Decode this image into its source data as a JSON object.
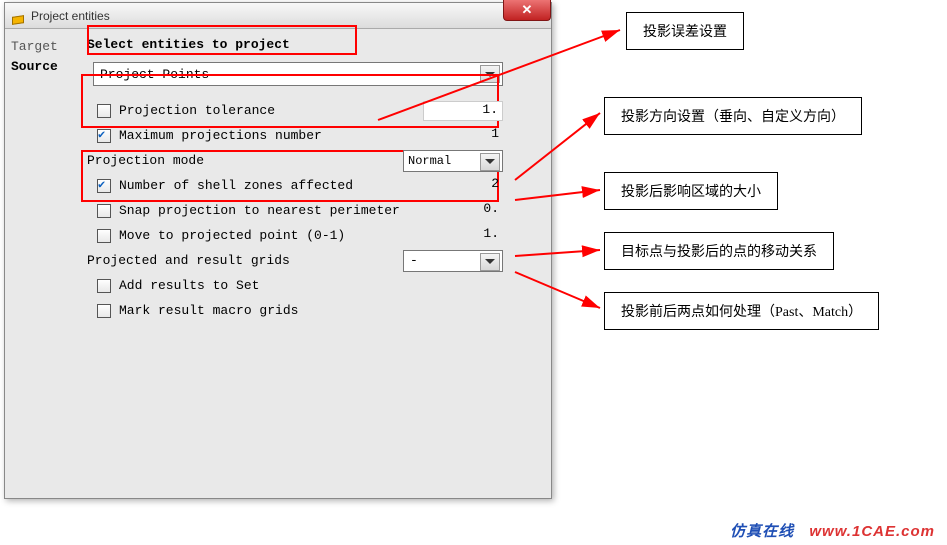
{
  "window": {
    "title": "Project entities",
    "close_glyph": "✕"
  },
  "sidebar": {
    "items": [
      {
        "label": "Target",
        "active": false
      },
      {
        "label": "Source",
        "active": true
      }
    ]
  },
  "main": {
    "heading": "Select entities to project",
    "dropdown_main": "Project Points",
    "rows": [
      {
        "id": "proj_tol",
        "checkbox": true,
        "checked": false,
        "label": "Projection tolerance",
        "value": "1.",
        "white": true
      },
      {
        "id": "max_proj",
        "checkbox": true,
        "checked": true,
        "label": "Maximum projections number",
        "value": "1",
        "white": false
      },
      {
        "id": "proj_mode",
        "checkbox": false,
        "label": "Projection mode",
        "select": "Normal"
      },
      {
        "id": "shell_zones",
        "checkbox": true,
        "checked": true,
        "label": "Number of shell zones affected",
        "value": "2",
        "white": false
      },
      {
        "id": "snap",
        "checkbox": true,
        "checked": false,
        "label": "Snap projection to nearest perimeter",
        "value": "0.",
        "white": false
      },
      {
        "id": "move_pt",
        "checkbox": true,
        "checked": false,
        "label": "Move to projected point (0-1)",
        "value": "1.",
        "white": false
      },
      {
        "id": "proj_grids",
        "checkbox": false,
        "label": "Projected and result grids",
        "select": "-"
      },
      {
        "id": "add_set",
        "checkbox": true,
        "checked": false,
        "label": "Add results to Set"
      },
      {
        "id": "mark_macro",
        "checkbox": true,
        "checked": false,
        "label": "Mark result macro grids"
      }
    ]
  },
  "annotations": [
    {
      "id": "a1",
      "text": "投影误差设置"
    },
    {
      "id": "a2",
      "text": "投影方向设置（垂向、自定义方向）"
    },
    {
      "id": "a3",
      "text": "投影后影响区域的大小"
    },
    {
      "id": "a4",
      "text": "目标点与投影后的点的移动关系"
    },
    {
      "id": "a5",
      "text": "投影前后两点如何处理（Past、Match）"
    }
  ],
  "footer": {
    "cn": "仿真在线",
    "url": "www.1CAE.com"
  }
}
